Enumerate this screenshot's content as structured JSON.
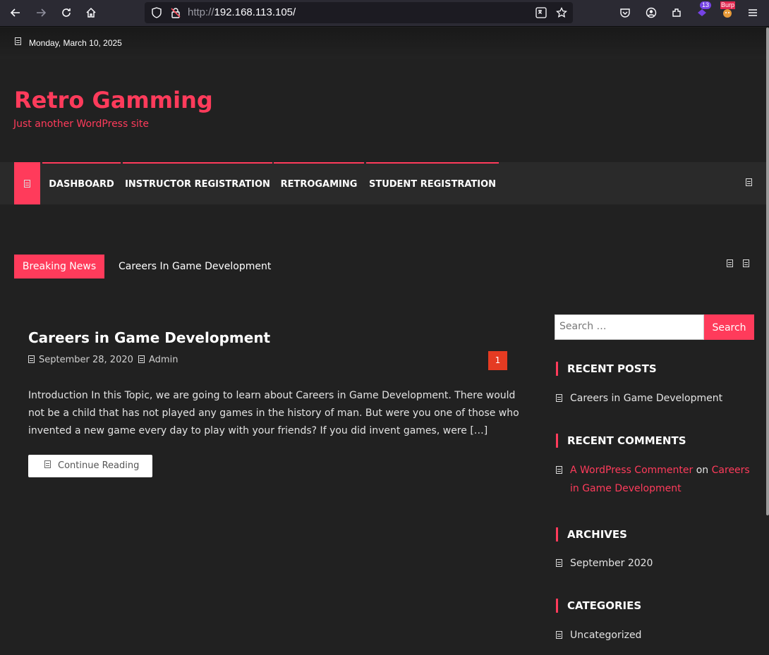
{
  "browser": {
    "url_protocol": "http://",
    "url_host": "192.168.113.105/",
    "extension_badge": "13",
    "burp_label": "Burp"
  },
  "topbar": {
    "date": "Monday, March 10, 2025"
  },
  "site": {
    "title": "Retro Gamming",
    "tagline": "Just another WordPress site"
  },
  "nav": {
    "items": [
      "DASHBOARD",
      "INSTRUCTOR REGISTRATION",
      "RETROGAMING",
      "STUDENT REGISTRATION"
    ]
  },
  "breaking": {
    "label": "Breaking News",
    "headline": "Careers In Game Development"
  },
  "post": {
    "title": "Careers in Game Development",
    "date": "September 28, 2020",
    "author": "Admin",
    "comments": "1",
    "excerpt": "Introduction In this Topic, we are going to learn about Careers in Game Development. There would not be a child that has not played any games in the history of man. But were you one of those who invented a new game every day to play with your friends? If you did invent games, were […]",
    "more_label": "Continue Reading"
  },
  "sidebar": {
    "search_placeholder": "Search …",
    "search_button": "Search",
    "recent_posts_title": "RECENT POSTS",
    "recent_posts": [
      "Careers in Game Development"
    ],
    "recent_comments_title": "RECENT COMMENTS",
    "comment_author": "A WordPress Commenter",
    "comment_on": "on",
    "comment_post": "Careers in Game Development",
    "archives_title": "ARCHIVES",
    "archives": [
      "September 2020"
    ],
    "categories_title": "CATEGORIES",
    "categories": [
      "Uncategorized"
    ]
  },
  "colors": {
    "accent": "#ff3b5b",
    "background": "#212121",
    "comment_badge": "#e53b22"
  }
}
